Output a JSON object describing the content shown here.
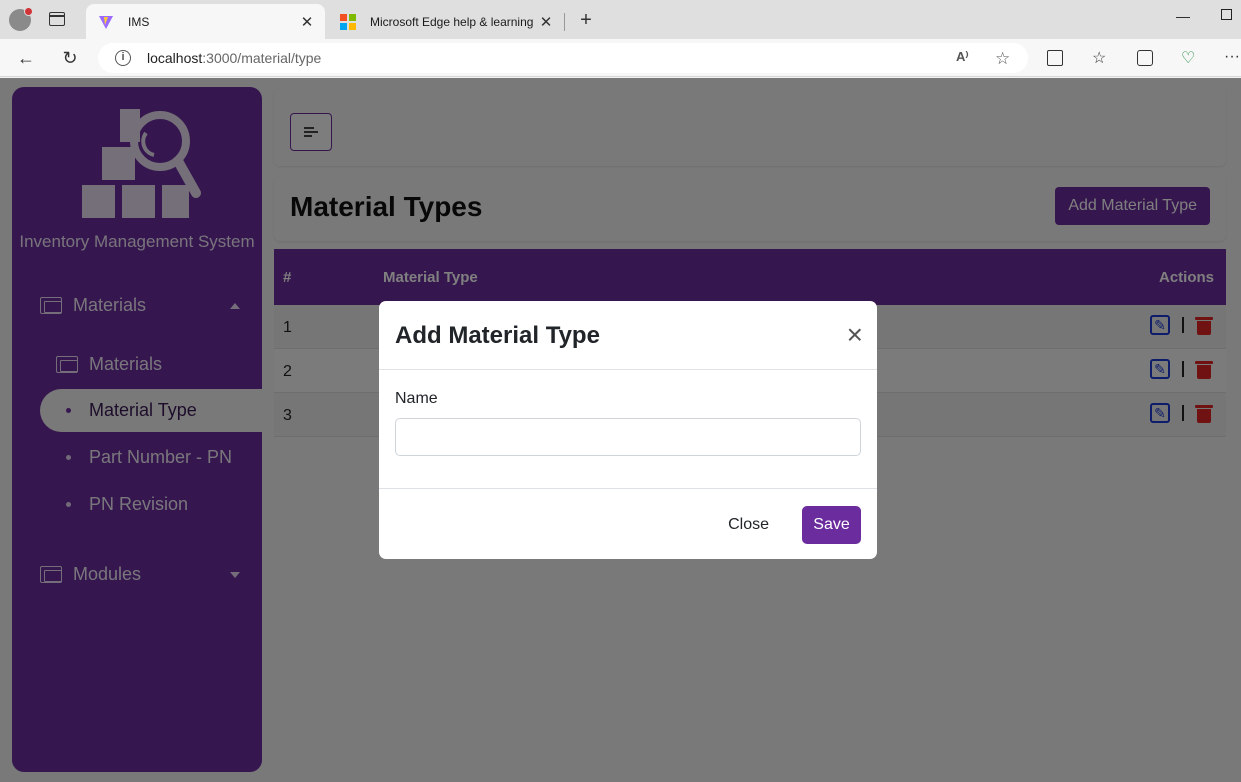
{
  "browser": {
    "tabs": [
      {
        "title": "IMS",
        "active": true,
        "favicon": "vite-icon"
      },
      {
        "title": "Microsoft Edge help & learning",
        "active": false,
        "favicon": "microsoft-icon"
      }
    ],
    "url_host": "localhost",
    "url_path": ":3000/material/type"
  },
  "sidebar": {
    "app_name": "Inventory Management System",
    "menu": [
      {
        "label": "Materials",
        "expanded": true
      },
      {
        "label": "Modules",
        "expanded": false
      }
    ],
    "sub_items": [
      {
        "label": "Materials"
      },
      {
        "label": "Material Type",
        "active": true
      },
      {
        "label": "Part Number - PN"
      },
      {
        "label": "PN Revision"
      }
    ]
  },
  "header": {
    "title": "Material Types",
    "add_button": "Add Material Type"
  },
  "table": {
    "columns": [
      "#",
      "Material Type",
      "Actions"
    ],
    "rows": [
      {
        "num": "1"
      },
      {
        "num": "2"
      },
      {
        "num": "3"
      }
    ]
  },
  "modal": {
    "title": "Add Material Type",
    "close_icon": "×",
    "field_label": "Name",
    "field_value": "",
    "close_button": "Close",
    "save_button": "Save"
  },
  "colors": {
    "brand": "#6b2d9e",
    "edit": "#1a3ad4",
    "delete": "#e02424"
  }
}
